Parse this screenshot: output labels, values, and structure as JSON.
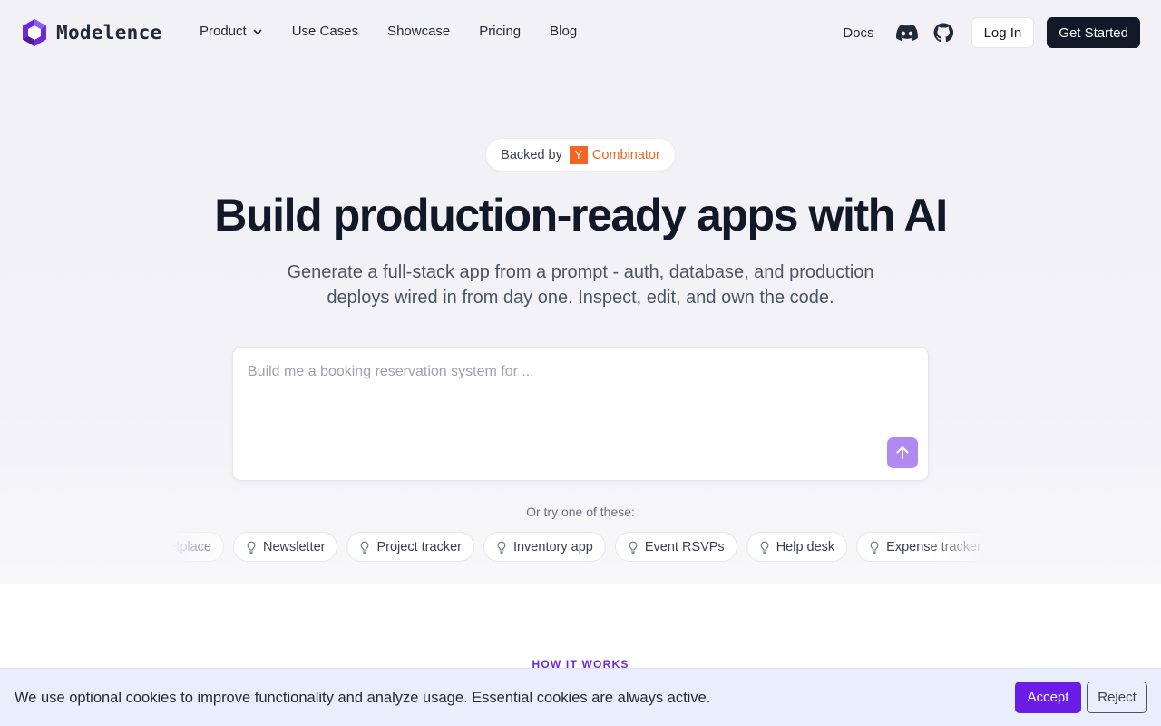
{
  "brand": {
    "name": "Modelence"
  },
  "nav": {
    "links": [
      {
        "label": "Product",
        "has_dropdown": true
      },
      {
        "label": "Use Cases"
      },
      {
        "label": "Showcase"
      },
      {
        "label": "Pricing"
      },
      {
        "label": "Blog"
      }
    ],
    "docs": "Docs",
    "discord_icon": "discord-icon",
    "github_icon": "github-icon",
    "login": "Log In",
    "get_started": "Get Started"
  },
  "badge": {
    "prefix": "Backed by",
    "yc_letter": "Y",
    "yc_text": "Combinator",
    "yc_color": "#f26522"
  },
  "hero": {
    "headline": "Build production-ready apps with AI",
    "subhead": "Generate a full-stack app from a prompt - auth, database, and production deploys wired in from day one. Inspect, edit, and own the code."
  },
  "prompt": {
    "placeholder": "Build me a booking reservation system for ...",
    "value": "",
    "send_icon": "arrow-up-icon",
    "send_color": "#b08af0"
  },
  "suggestions": {
    "label": "Or try one of these:",
    "chips": [
      "Marketplace",
      "Newsletter",
      "Project tracker",
      "Inventory app",
      "Event RSVPs",
      "Help desk",
      "Expense tracker"
    ]
  },
  "section": {
    "how_it_works": "HOW IT WORKS"
  },
  "cookie": {
    "text": "We use optional cookies to improve functionality and analyze usage. Essential cookies are always active.",
    "accept": "Accept",
    "reject": "Reject",
    "accent": "#6b1de8"
  }
}
